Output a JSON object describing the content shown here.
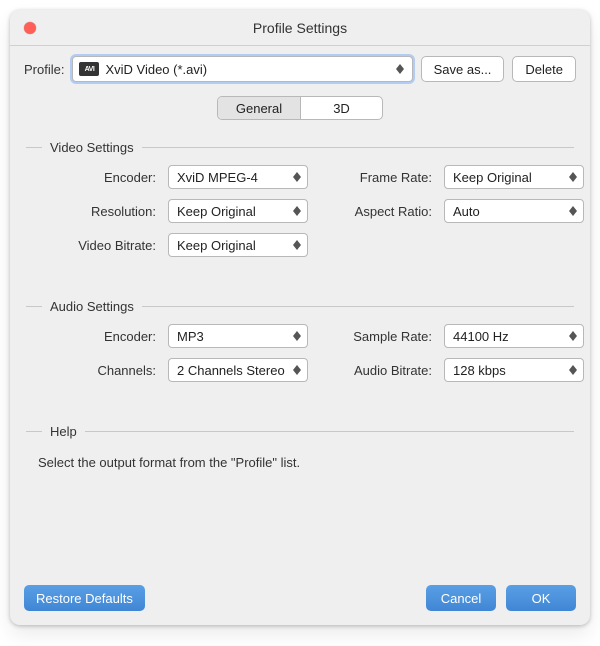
{
  "window": {
    "title": "Profile Settings"
  },
  "toolbar": {
    "profile_label": "Profile:",
    "profile_value": "XviD Video (*.avi)",
    "profile_icon_text": "AVI",
    "save_as": "Save as...",
    "delete": "Delete"
  },
  "tabs": {
    "general": "General",
    "three_d": "3D",
    "active": "general"
  },
  "video": {
    "section_title": "Video Settings",
    "encoder_label": "Encoder:",
    "encoder_value": "XviD MPEG-4",
    "frame_rate_label": "Frame Rate:",
    "frame_rate_value": "Keep Original",
    "resolution_label": "Resolution:",
    "resolution_value": "Keep Original",
    "aspect_ratio_label": "Aspect Ratio:",
    "aspect_ratio_value": "Auto",
    "video_bitrate_label": "Video Bitrate:",
    "video_bitrate_value": "Keep Original"
  },
  "audio": {
    "section_title": "Audio Settings",
    "encoder_label": "Encoder:",
    "encoder_value": "MP3",
    "sample_rate_label": "Sample Rate:",
    "sample_rate_value": "44100 Hz",
    "channels_label": "Channels:",
    "channels_value": "2 Channels Stereo",
    "audio_bitrate_label": "Audio Bitrate:",
    "audio_bitrate_value": "128 kbps"
  },
  "help": {
    "section_title": "Help",
    "text": "Select the output format from the \"Profile\" list."
  },
  "footer": {
    "restore": "Restore Defaults",
    "cancel": "Cancel",
    "ok": "OK"
  }
}
